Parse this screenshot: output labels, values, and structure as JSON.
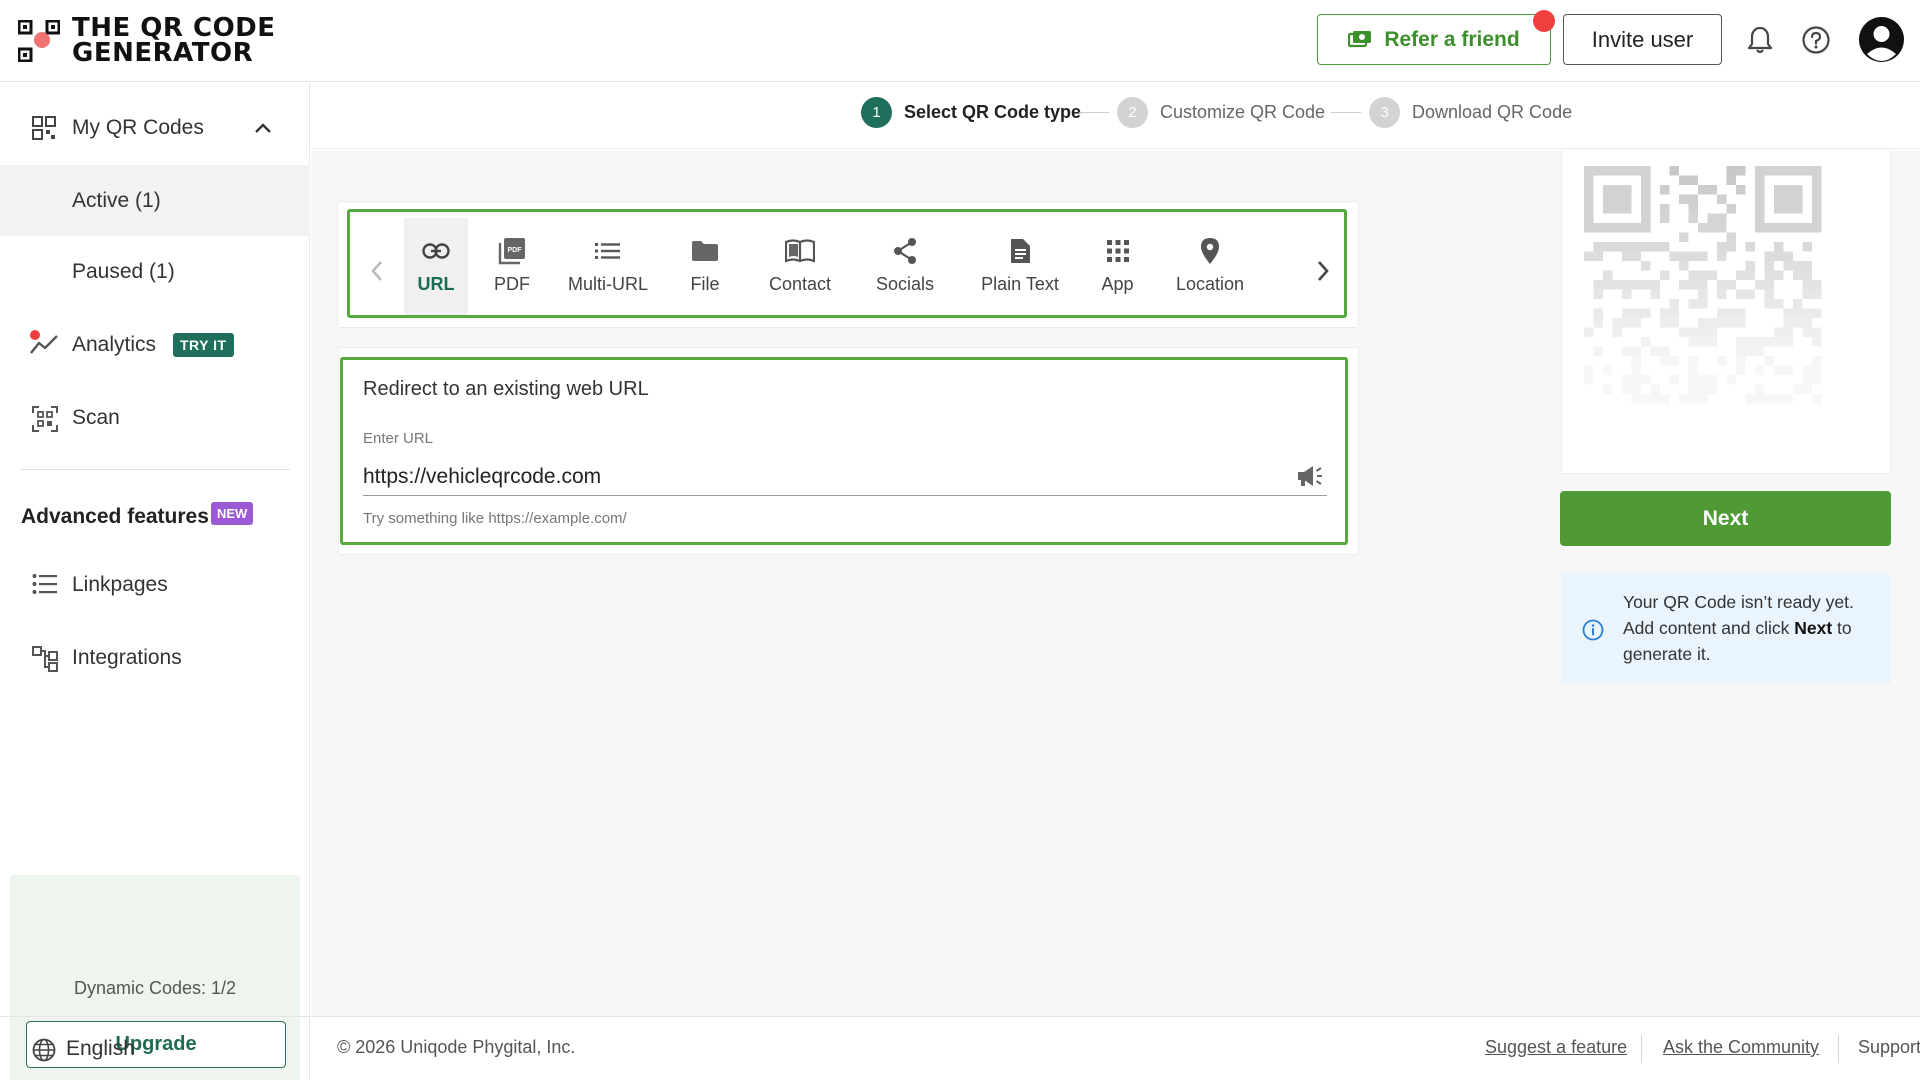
{
  "header": {
    "logo_line1": "THE QR CODE",
    "logo_line2": "GENERATOR",
    "refer_label": "Refer a friend",
    "invite_label": "Invite user",
    "bell_icon": "bell-icon",
    "help_icon": "help-icon",
    "avatar_icon": "user-avatar-icon"
  },
  "sidebar": {
    "my_qr_codes": "My QR Codes",
    "active": "Active (1)",
    "paused": "Paused (1)",
    "analytics": "Analytics",
    "analytics_badge": "TRY IT",
    "scan": "Scan",
    "advanced_title": "Advanced features",
    "advanced_badge": "NEW",
    "linkpages": "Linkpages",
    "integrations": "Integrations",
    "plan_text": "Dynamic Codes: 1/2",
    "upgrade_label": "Upgrade",
    "language": "English"
  },
  "stepper": {
    "steps": [
      {
        "num": "1",
        "label": "Select QR Code type"
      },
      {
        "num": "2",
        "label": "Customize QR Code"
      },
      {
        "num": "3",
        "label": "Download QR Code"
      }
    ],
    "active_step": 1
  },
  "types": {
    "items": [
      {
        "label": "URL",
        "icon": "link-icon"
      },
      {
        "label": "PDF",
        "icon": "pdf-icon"
      },
      {
        "label": "Multi-URL",
        "icon": "list-icon"
      },
      {
        "label": "File",
        "icon": "folder-icon"
      },
      {
        "label": "Contact",
        "icon": "contact-book-icon"
      },
      {
        "label": "Socials",
        "icon": "share-icon"
      },
      {
        "label": "Plain Text",
        "icon": "text-document-icon"
      },
      {
        "label": "App",
        "icon": "app-grid-icon"
      },
      {
        "label": "Location",
        "icon": "location-pin-icon"
      }
    ],
    "selected": "URL"
  },
  "url_form": {
    "title": "Redirect to an existing web URL",
    "label": "Enter URL",
    "value": "https://vehicleqrcode.com",
    "hint": "Try something like https://example.com/"
  },
  "preview": {
    "next_label": "Next",
    "info_prefix": "Your QR Code isn’t ready yet. Add content and click ",
    "info_bold": "Next",
    "info_suffix": " to generate it."
  },
  "footer": {
    "copyright": "© 2026 Uniqode Phygital, Inc.",
    "links": [
      "Suggest a feature",
      "Ask the Community",
      "Support"
    ]
  },
  "colors": {
    "brand_green": "#4f9a35",
    "dark_teal": "#1f6f5c",
    "alert_red": "#ef3f3f",
    "new_purple": "#9b59d6",
    "info_bg": "#eaf4fc"
  }
}
